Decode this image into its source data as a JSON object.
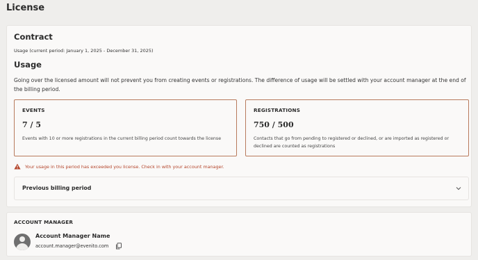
{
  "page": {
    "title": "License"
  },
  "contract": {
    "title": "Contract",
    "period_text": "Usage (current period: January 1, 2025 - December 31, 2025)",
    "usage_heading": "Usage",
    "usage_description": "Going over the licensed amount will not prevent you from creating events or registrations. The difference of usage will be settled with your account manager at the end of the billing period.",
    "stats": {
      "events": {
        "label": "EVENTS",
        "value": "7 / 5",
        "note": "Events with 10 or more registrations in the current billing period count towards the license"
      },
      "registrations": {
        "label": "REGISTRATIONS",
        "value": "750 / 500",
        "note": "Contacts that go from pending to registered or declined, or are imported as registered or declined are counted as registrations"
      }
    },
    "warning_text": "Your usage in this period has exceeded you license. Check in with your account manager.",
    "previous_period_label": "Previous billing period"
  },
  "account_manager": {
    "heading": "ACCOUNT MANAGER",
    "name": "Account Manager Name",
    "email": "account.manager@evenito.com"
  },
  "colors": {
    "accent_border": "#b87a5c",
    "warning": "#b4452b",
    "background": "#efeeec",
    "card": "#faf9f8"
  },
  "icons": {
    "warning": "warning-triangle-icon",
    "chevron": "chevron-down-icon",
    "avatar": "person-avatar-icon",
    "copy": "copy-icon"
  }
}
